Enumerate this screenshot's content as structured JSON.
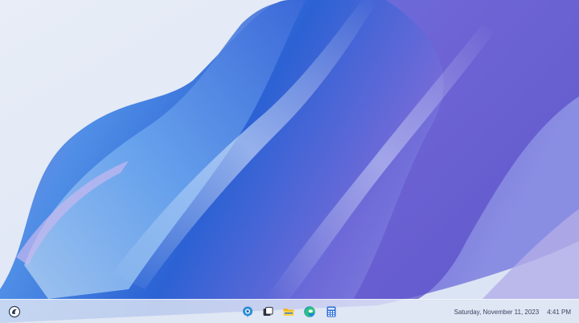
{
  "desktop": {
    "wallpaper": "silk-ribbon-wallpaper",
    "background_color": "#dfe7f4",
    "accent_colors": [
      "#2f6fd8",
      "#5a4ec9",
      "#8a7ce0",
      "#9fc6ee"
    ]
  },
  "taskbar": {
    "start_icon": "copilot-icon",
    "pinned_apps": [
      {
        "name": "copilot-app",
        "icon": "copilot-icon"
      },
      {
        "name": "task-view",
        "icon": "task-view-icon"
      },
      {
        "name": "file-explorer",
        "icon": "folder-icon"
      },
      {
        "name": "edge-browser",
        "icon": "edge-icon"
      },
      {
        "name": "calculator",
        "icon": "calculator-icon"
      }
    ],
    "date": "Saturday, November 11, 2023",
    "time": "4:41 PM"
  }
}
